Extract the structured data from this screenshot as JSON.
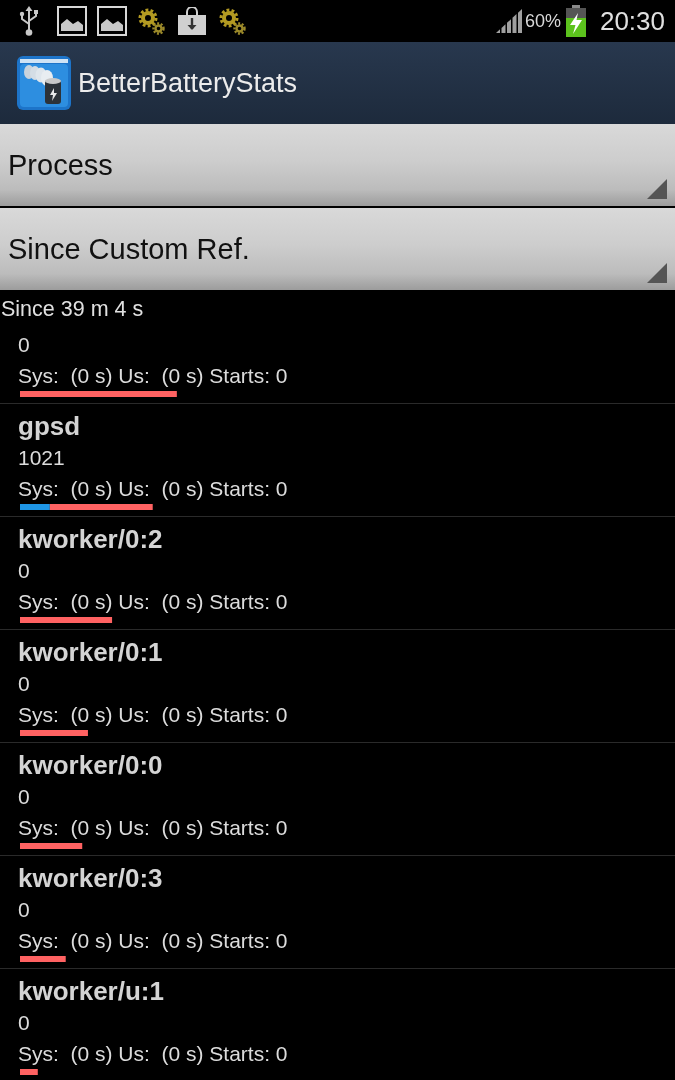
{
  "status_bar": {
    "battery_percent": "60%",
    "charging": true,
    "time": "20:30"
  },
  "app_bar": {
    "title": "BetterBatteryStats"
  },
  "spinners": [
    {
      "value": "Process"
    },
    {
      "value": "Since Custom Ref."
    }
  ],
  "since": "Since 39 m 4 s",
  "processes": [
    {
      "uid": "0",
      "stats": "Sys:  (0 s) Us:  (0 s) Starts: 0",
      "bar": [
        {
          "level": 0.247,
          "color": "#ff6262"
        }
      ]
    },
    {
      "name": "gpsd",
      "uid": "1021",
      "stats": "Sys:  (0 s) Us:  (0 s) Starts: 0",
      "bar": [
        {
          "level": 0.047,
          "color": "#1e96e6"
        },
        {
          "level": 0.162,
          "color": "#ff6262"
        }
      ]
    },
    {
      "name": "kworker/0:2",
      "uid": "0",
      "stats": "Sys:  (0 s) Us:  (0 s) Starts: 0",
      "bar": [
        {
          "level": 0.145,
          "color": "#ff6262"
        }
      ]
    },
    {
      "name": "kworker/0:1",
      "uid": "0",
      "stats": "Sys:  (0 s) Us:  (0 s) Starts: 0",
      "bar": [
        {
          "level": 0.107,
          "color": "#ff6262"
        }
      ]
    },
    {
      "name": "kworker/0:0",
      "uid": "0",
      "stats": "Sys:  (0 s) Us:  (0 s) Starts: 0",
      "bar": [
        {
          "level": 0.098,
          "color": "#ff6262"
        }
      ]
    },
    {
      "name": "kworker/0:3",
      "uid": "0",
      "stats": "Sys:  (0 s) Us:  (0 s) Starts: 0",
      "bar": [
        {
          "level": 0.072,
          "color": "#ff6262"
        }
      ]
    },
    {
      "name": "kworker/u:1",
      "uid": "0",
      "stats": "Sys:  (0 s) Us:  (0 s) Starts: 0",
      "bar": [
        {
          "level": 0.028,
          "color": "#ff6262"
        }
      ]
    }
  ]
}
